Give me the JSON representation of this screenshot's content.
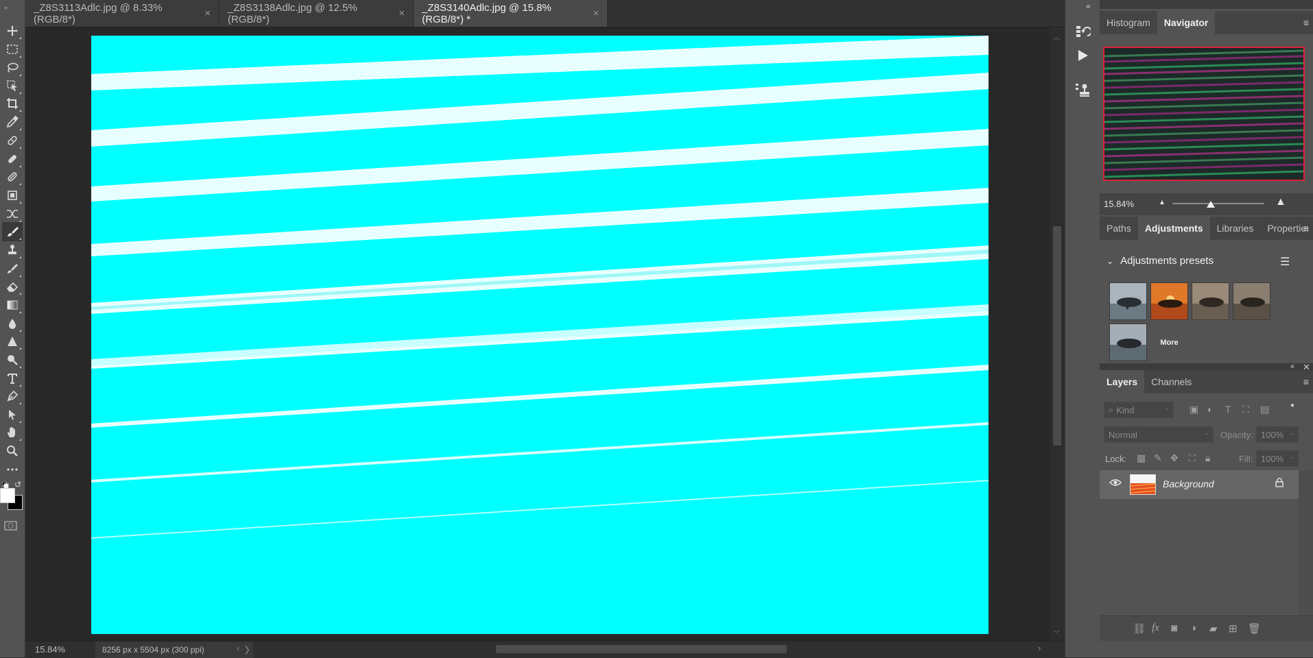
{
  "tabs": [
    {
      "label": "_Z8S3113Adlc.jpg @ 8.33% (RGB/8*)",
      "close": "×"
    },
    {
      "label": "_Z8S3138Adlc.jpg @ 12.5% (RGB/8*)",
      "close": "×"
    },
    {
      "label": "_Z8S3140Adlc.jpg @ 15.8% (RGB/8*) *",
      "close": "×"
    }
  ],
  "active_tab_index": 2,
  "toolbar": {
    "tools": [
      "move-tool",
      "marquee-tool",
      "lasso-tool",
      "object-select-tool",
      "crop-tool",
      "eyedropper-tool",
      "spot-healing-tool",
      "healing-brush-tool",
      "patch-tool",
      "content-aware-tool",
      "remix-tool",
      "brush-tool",
      "clone-stamp-tool",
      "history-brush-tool",
      "eraser-tool",
      "gradient-tool",
      "blur-tool",
      "sharpen-tool",
      "dodge-tool",
      "type-tool",
      "pen-tool",
      "path-select-tool",
      "hand-tool",
      "zoom-tool",
      "more-tools"
    ],
    "active_tool": "brush-tool",
    "foreground_color": "#ffffff",
    "background_color": "#000000"
  },
  "canvas": {
    "fill_color": "#00ffff",
    "stripe_color": "#e8ffff"
  },
  "status": {
    "zoom": "15.84%",
    "doc_info": "8256 px x 5504 px (300 ppi)",
    "arrow": "〉"
  },
  "strip": {
    "collapse": "«",
    "buttons": [
      "history-icon",
      "play-icon",
      "clone-source-icon"
    ]
  },
  "navigator": {
    "tabs": [
      "Histogram",
      "Navigator"
    ],
    "active": "Navigator",
    "zoom": "15.84%",
    "zoom_slider_fraction": 0.42
  },
  "adjustments": {
    "tabs": [
      "Paths",
      "Adjustments",
      "Libraries",
      "Properties"
    ],
    "active": "Adjustments",
    "section_title": "Adjustments presets",
    "presets": [
      "preset-bw-1",
      "preset-sunset",
      "preset-warm",
      "preset-vintage",
      "preset-bw-2"
    ],
    "more_label": "More"
  },
  "layers": {
    "tabs": [
      "Layers",
      "Channels"
    ],
    "active": "Layers",
    "filter_placeholder": "Kind",
    "blend_mode": "Normal",
    "opacity_label": "Opacity:",
    "opacity_value": "100%",
    "lock_label": "Lock:",
    "fill_label": "Fill:",
    "fill_value": "100%",
    "items": [
      {
        "name": "Background",
        "visible": true,
        "locked": true
      }
    ]
  }
}
